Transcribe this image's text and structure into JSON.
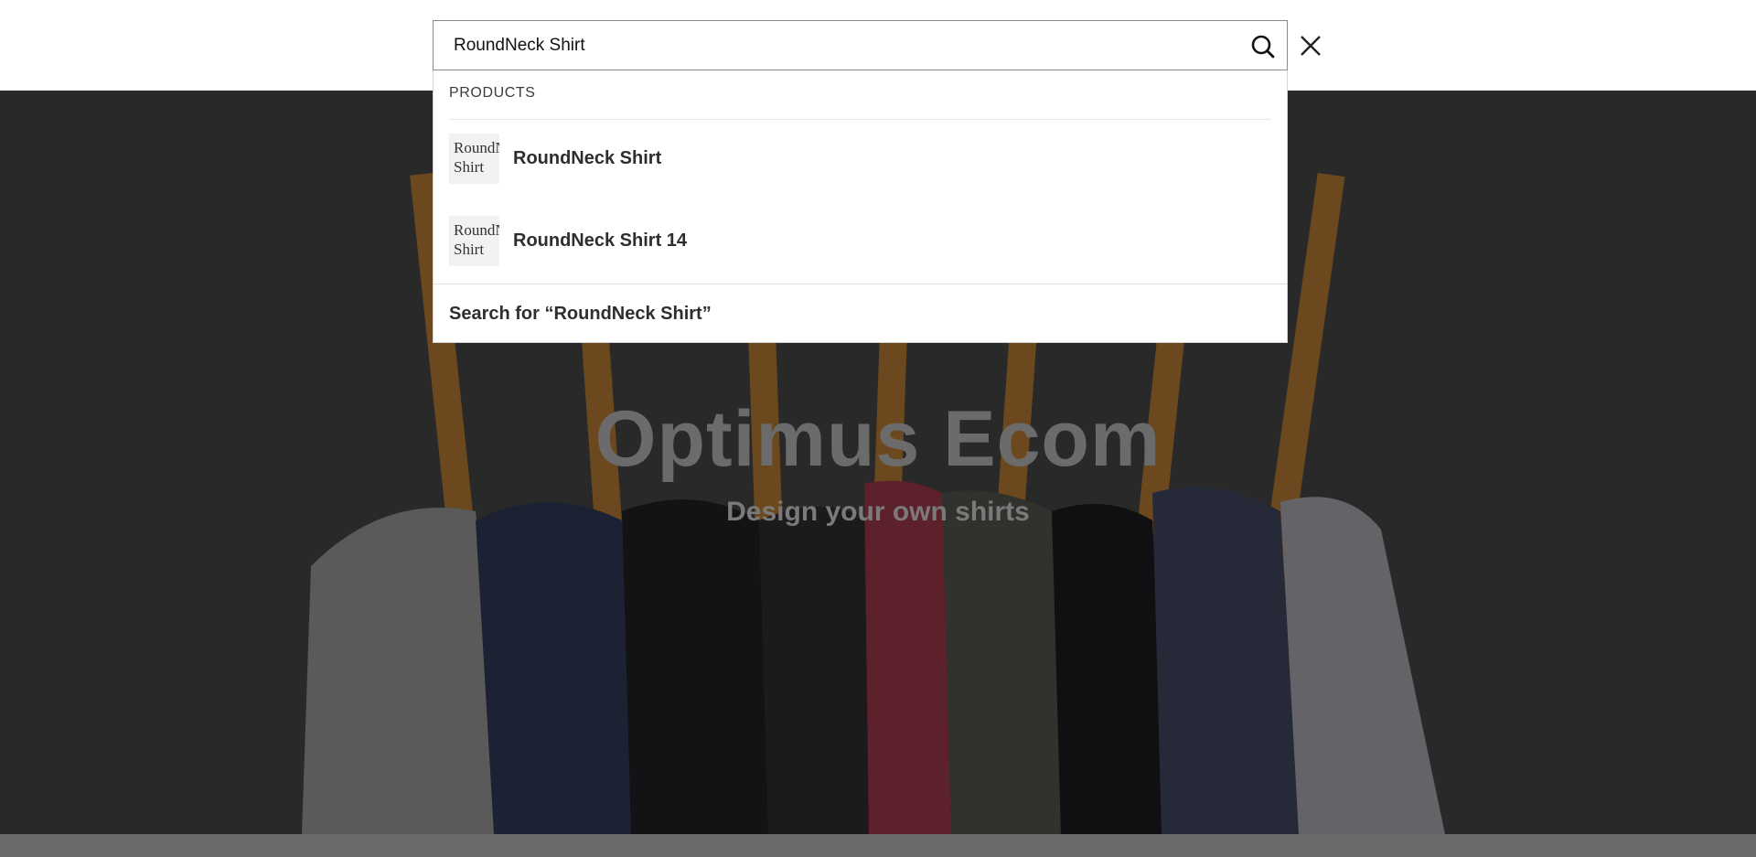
{
  "search": {
    "value": "RoundNeck Shirt",
    "submit_icon": "search-icon",
    "close_icon": "close-icon"
  },
  "dropdown": {
    "heading": "PRODUCTS",
    "results": [
      {
        "thumb_text": "RoundNeck Shirt",
        "label": "RoundNeck Shirt"
      },
      {
        "thumb_text": "RoundNeck Shirt",
        "label": "RoundNeck Shirt 14"
      }
    ],
    "search_for": "Search for “RoundNeck Shirt”"
  },
  "hero": {
    "title": "Optimus Ecom",
    "subtitle": "Design your own shirts"
  },
  "colors": {
    "overlay": "#000000",
    "text_dark": "#2e2e2e",
    "hero_title": "#6b6b6b"
  }
}
